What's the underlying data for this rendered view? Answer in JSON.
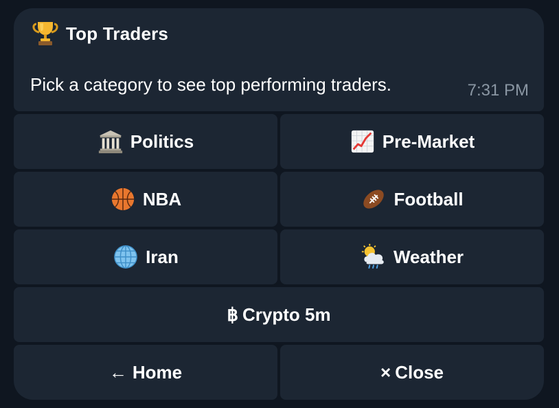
{
  "message": {
    "title": "Top Traders",
    "title_icon": "trophy-icon",
    "body": "Pick a category to see top performing traders.",
    "time": "7:31 PM"
  },
  "buttons": {
    "politics": {
      "label": "Politics",
      "icon": "classical-building-icon"
    },
    "premarket": {
      "label": "Pre-Market",
      "icon": "chart-increasing-icon"
    },
    "nba": {
      "label": "NBA",
      "icon": "basketball-icon"
    },
    "football": {
      "label": "Football",
      "icon": "american-football-icon"
    },
    "iran": {
      "label": "Iran",
      "icon": "globe-icon"
    },
    "weather": {
      "label": "Weather",
      "icon": "sun-behind-rain-cloud-icon"
    },
    "crypto": {
      "label": "Crypto 5m",
      "glyph": "฿"
    },
    "home": {
      "label": "Home",
      "glyph": "←"
    },
    "close": {
      "label": "Close",
      "glyph": "×"
    }
  },
  "colors": {
    "background": "#0f1620",
    "bubble": "#1c2633",
    "text": "#ffffff",
    "timestamp": "#8a96a3"
  }
}
